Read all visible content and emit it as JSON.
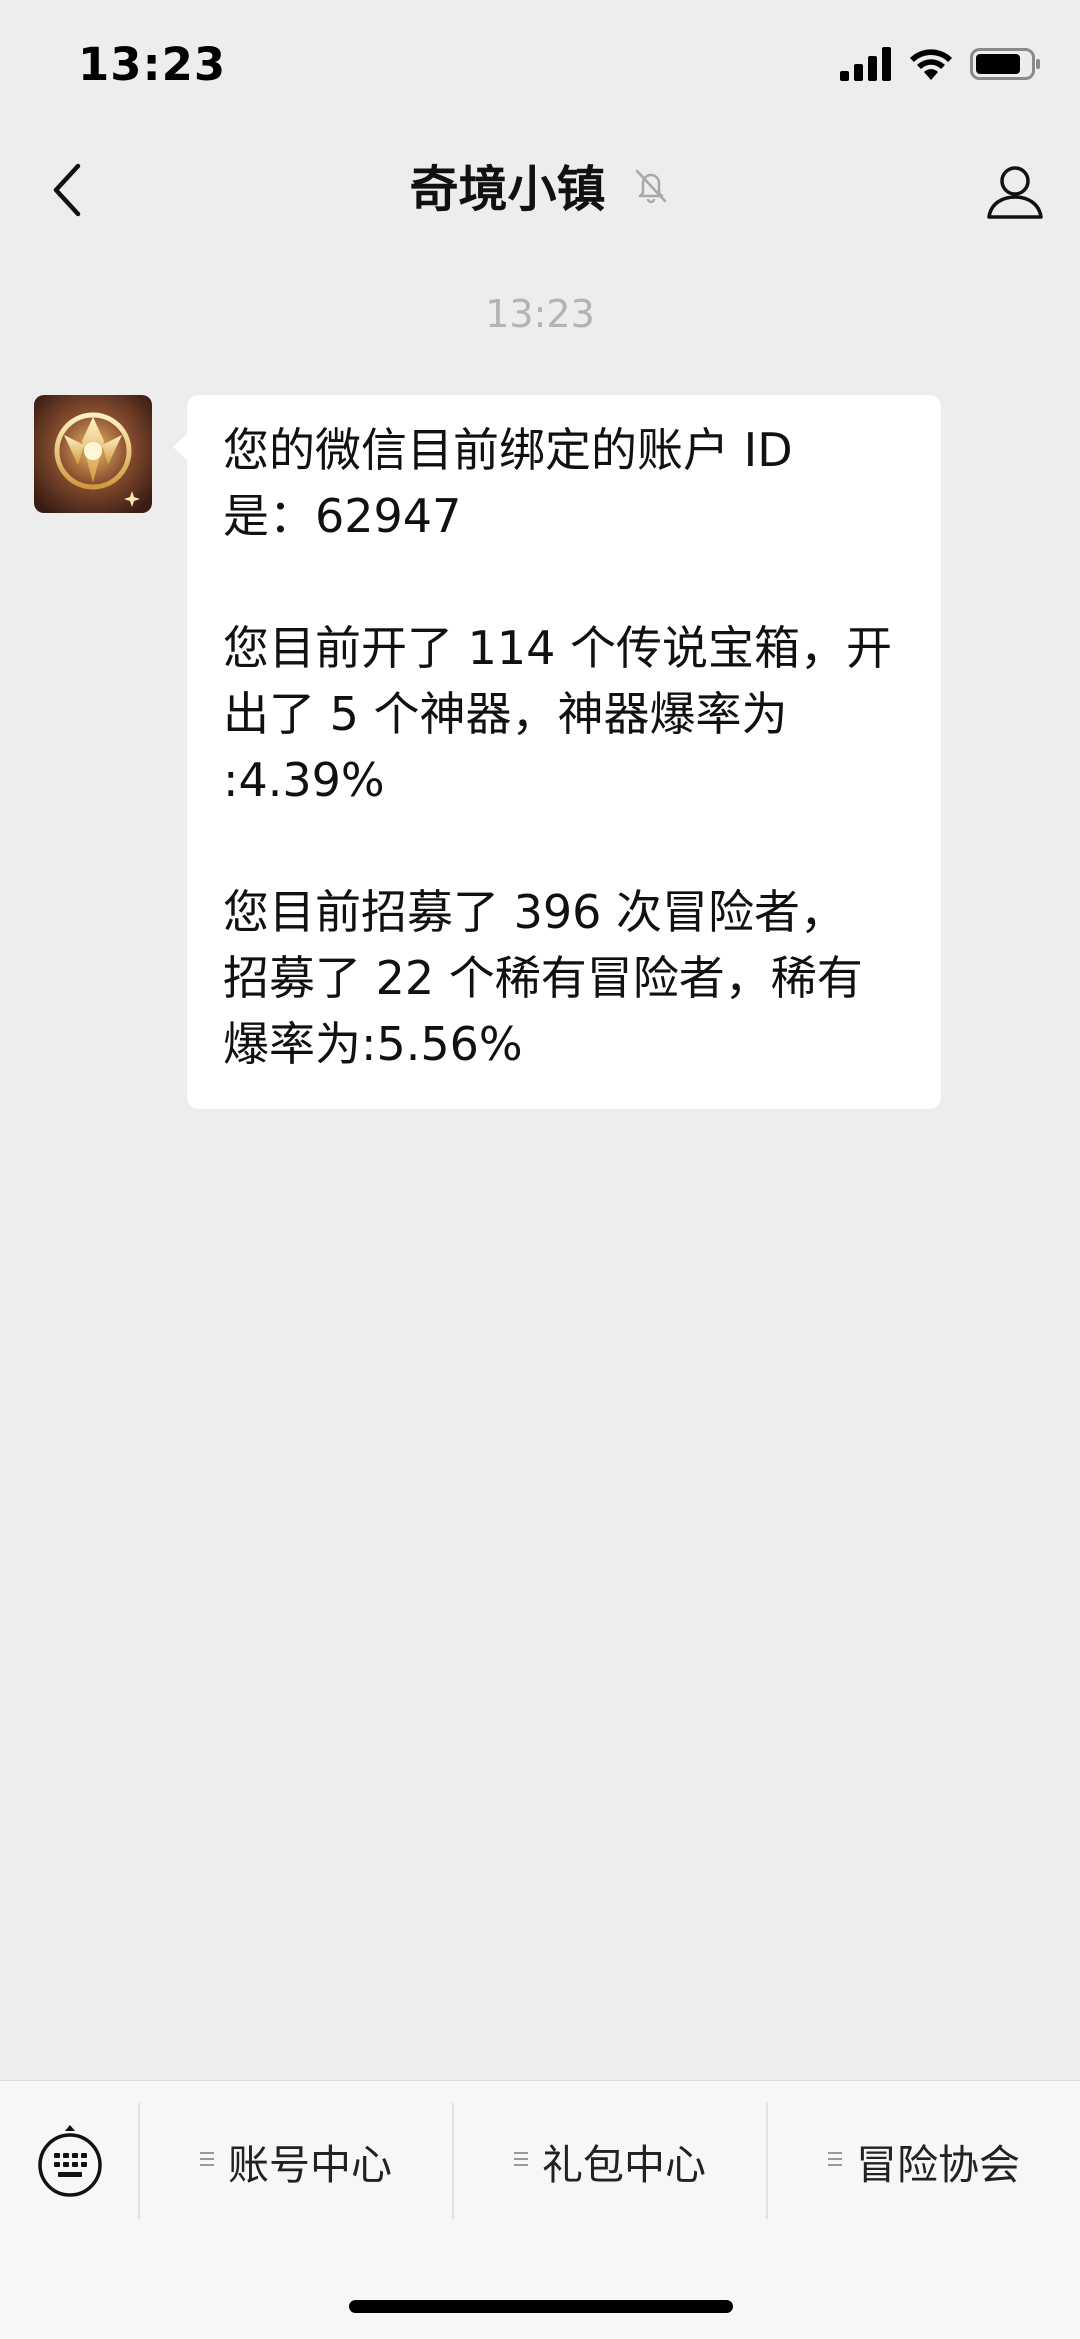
{
  "status_bar": {
    "time": "13:23",
    "icons": [
      "signal-icon",
      "wifi-icon",
      "battery-icon"
    ]
  },
  "nav": {
    "title": "奇境小镇",
    "icons": [
      "back-chevron-icon",
      "mute-bell-icon",
      "profile-icon"
    ]
  },
  "chat": {
    "timestamp": "13:23",
    "message": {
      "avatar": "golden-emblem-avatar",
      "paragraphs": [
        "您的微信目前绑定的账户 ID\n是：62947",
        "您目前开了 114 个传说宝箱，开\n出了 5 个神器，神器爆率为\n:4.39%",
        "您目前招募了 396 次冒险者，\n招募了 22 个稀有冒险者，稀有\n爆率为:5.56%"
      ]
    }
  },
  "bottom_menu": {
    "items": [
      {
        "label": "账号中心"
      },
      {
        "label": "礼包中心"
      },
      {
        "label": "冒险协会"
      }
    ],
    "icons": [
      "keyboard-icon",
      "menu-lines-icon"
    ]
  },
  "colors": {
    "background": "#ededed",
    "bubble": "#ffffff",
    "timestamp": "#b3b3b3",
    "bottom_bar": "#f7f7f7"
  }
}
